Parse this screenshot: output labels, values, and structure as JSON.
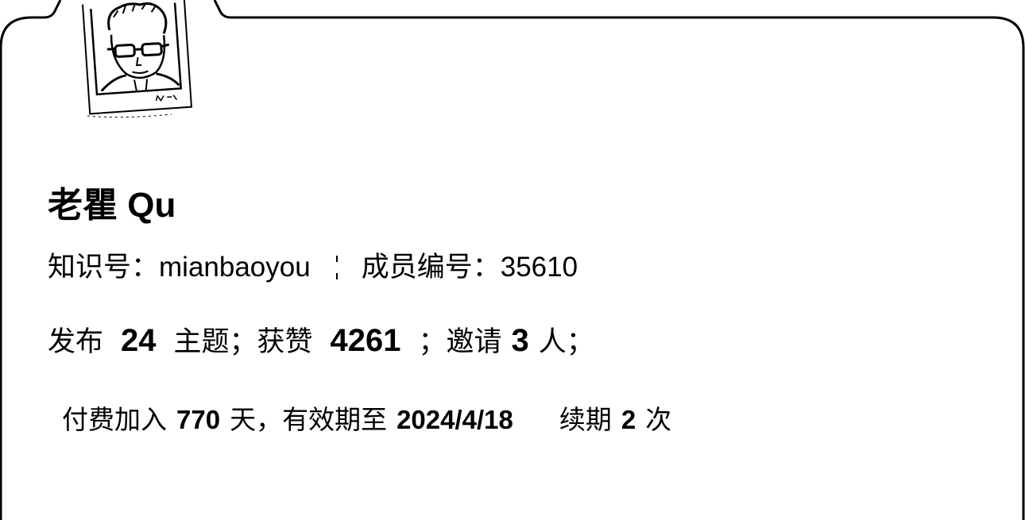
{
  "profile": {
    "name": "老瞿 Qu",
    "id_label": "知识号：",
    "id_value": "mianbaoyou",
    "member_label": "成员编号：",
    "member_value": "35610",
    "avatar_icon": "portrait-sketch-icon"
  },
  "stats": {
    "publish_prefix": "发布",
    "topics_count": "24",
    "topics_suffix": "主题；获赞",
    "likes_count": "4261",
    "likes_suffix": "；邀请",
    "invites_count": "3",
    "invites_suffix": "人；"
  },
  "membership": {
    "join_prefix": "付费加入",
    "days": "770",
    "days_suffix": "天，有效期至",
    "expiry_date": "2024/4/18",
    "renew_prefix": "续期",
    "renew_count": "2",
    "renew_suffix": "次"
  },
  "colors": {
    "background": "#ffffff",
    "ink": "#000000"
  }
}
